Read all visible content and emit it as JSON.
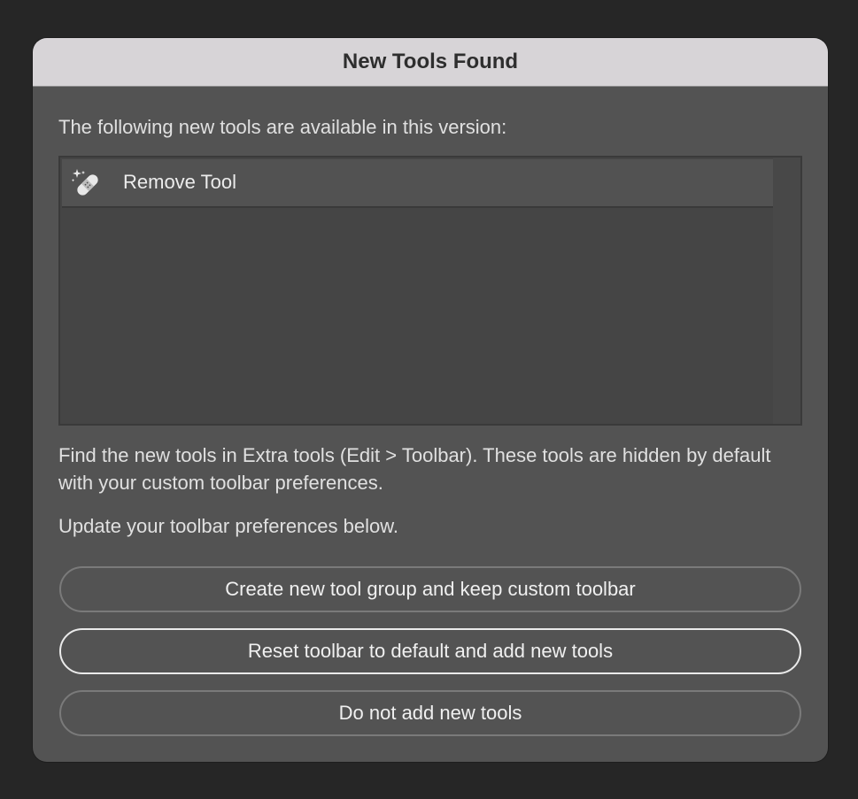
{
  "dialog": {
    "title": "New Tools Found",
    "intro": "The following new tools are available in this version:",
    "tools": [
      {
        "name": "Remove Tool",
        "icon": "bandage-sparkle-icon"
      }
    ],
    "info_text": "Find the new tools in Extra tools (Edit > Toolbar). These tools are hidden by default with your custom toolbar preferences.",
    "update_text": "Update your toolbar preferences below.",
    "buttons": {
      "create_group": "Create new tool group and keep custom toolbar",
      "reset_toolbar": "Reset toolbar to default and add new tools",
      "do_not_add": "Do not add new tools"
    },
    "colors": {
      "background": "#262626",
      "panel": "#535353",
      "titlebar": "#d7d4d7",
      "primary_border": "#eaeaea",
      "secondary_border": "#7a7a7a"
    }
  }
}
